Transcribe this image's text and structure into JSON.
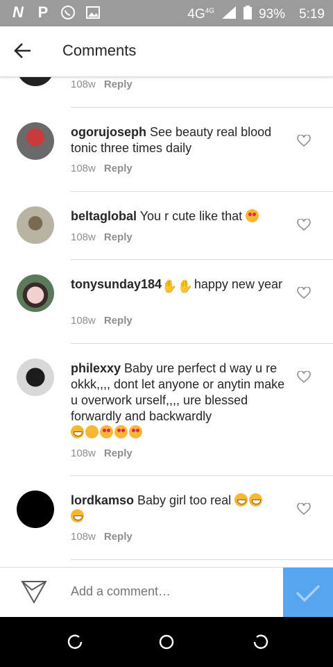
{
  "status_bar": {
    "network": "4G",
    "network_small": "4G",
    "battery": "93%",
    "time": "5:19",
    "icons": [
      "n-icon",
      "p-icon",
      "whatsapp-icon",
      "gallery-icon",
      "signal-icon",
      "battery-icon"
    ]
  },
  "header": {
    "title": "Comments"
  },
  "comments": [
    {
      "user": "",
      "text": "",
      "time": "108w",
      "reply": "Reply"
    },
    {
      "user": "ogorujoseph",
      "text": " See beauty real blood tonic three times daily",
      "time": "108w",
      "reply": "Reply"
    },
    {
      "user": "beltaglobal",
      "text": " You r cute like that ",
      "time": "108w",
      "reply": "Reply"
    },
    {
      "user": "tonysunday184",
      "text": "happy new year",
      "time": "108w",
      "reply": "Reply"
    },
    {
      "user": "philexxy",
      "text": " Baby ure perfect d way u re okkk,,,, dont let anyone or anytin make u overwork urself,,,, ure blessed forwardly and backwardly",
      "time": "108w",
      "reply": "Reply"
    },
    {
      "user": "lordkamso",
      "text": " Baby girl too real ",
      "time": "108w",
      "reply": "Reply"
    }
  ],
  "input": {
    "placeholder": "Add a comment…"
  },
  "colors": {
    "status_bar": "#9b9b9b",
    "post_button": "#55a6ee",
    "meta_text": "#8e8e8e",
    "divider": "#dbdbdb"
  }
}
